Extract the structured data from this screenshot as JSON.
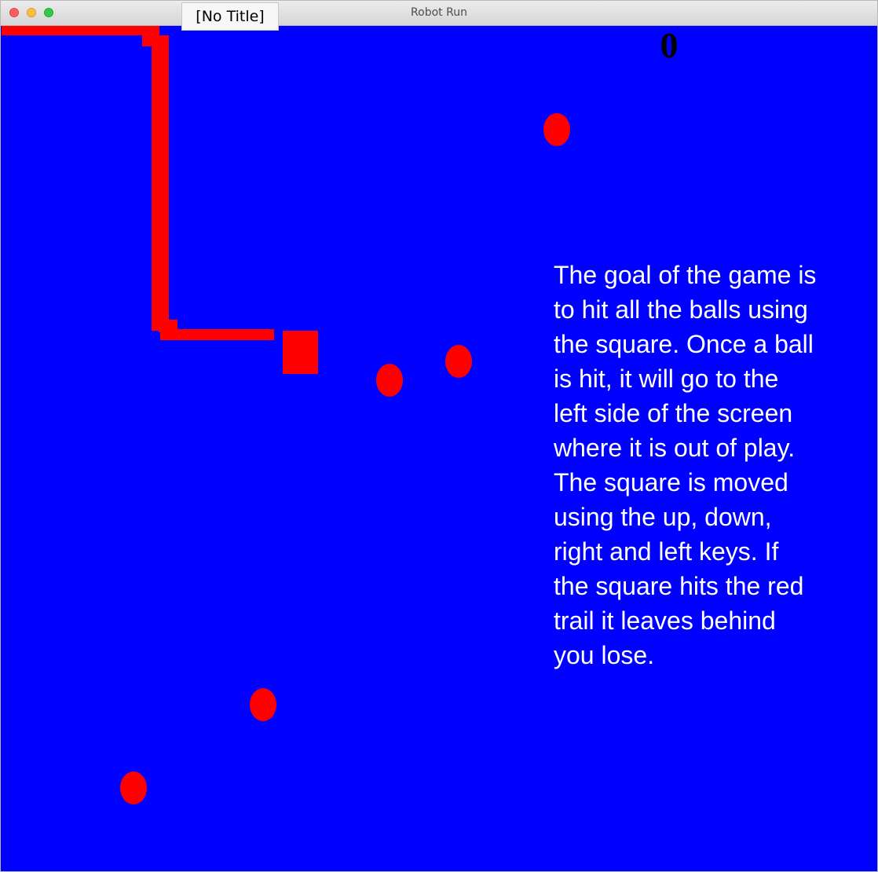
{
  "window": {
    "title": "Robot Run",
    "tooltip": "[No Title]"
  },
  "game": {
    "score": "0",
    "instructions": [
      "The goal of the game is",
      "to hit all the balls using",
      "the square. Once a ball",
      "is hit, it will go to the",
      "left side of the screen",
      "where it is out of play.",
      "The square is moved",
      "using the up, down,",
      "right and left keys. If",
      "the square hits the red",
      "trail it leaves behind",
      "you lose."
    ],
    "balls_remaining": 5
  },
  "colors": {
    "background": "#0000ff",
    "trail": "#ff0000",
    "ball": "#ff0000",
    "player": "#ff0000",
    "text": "#ffffff",
    "score": "#000000"
  }
}
